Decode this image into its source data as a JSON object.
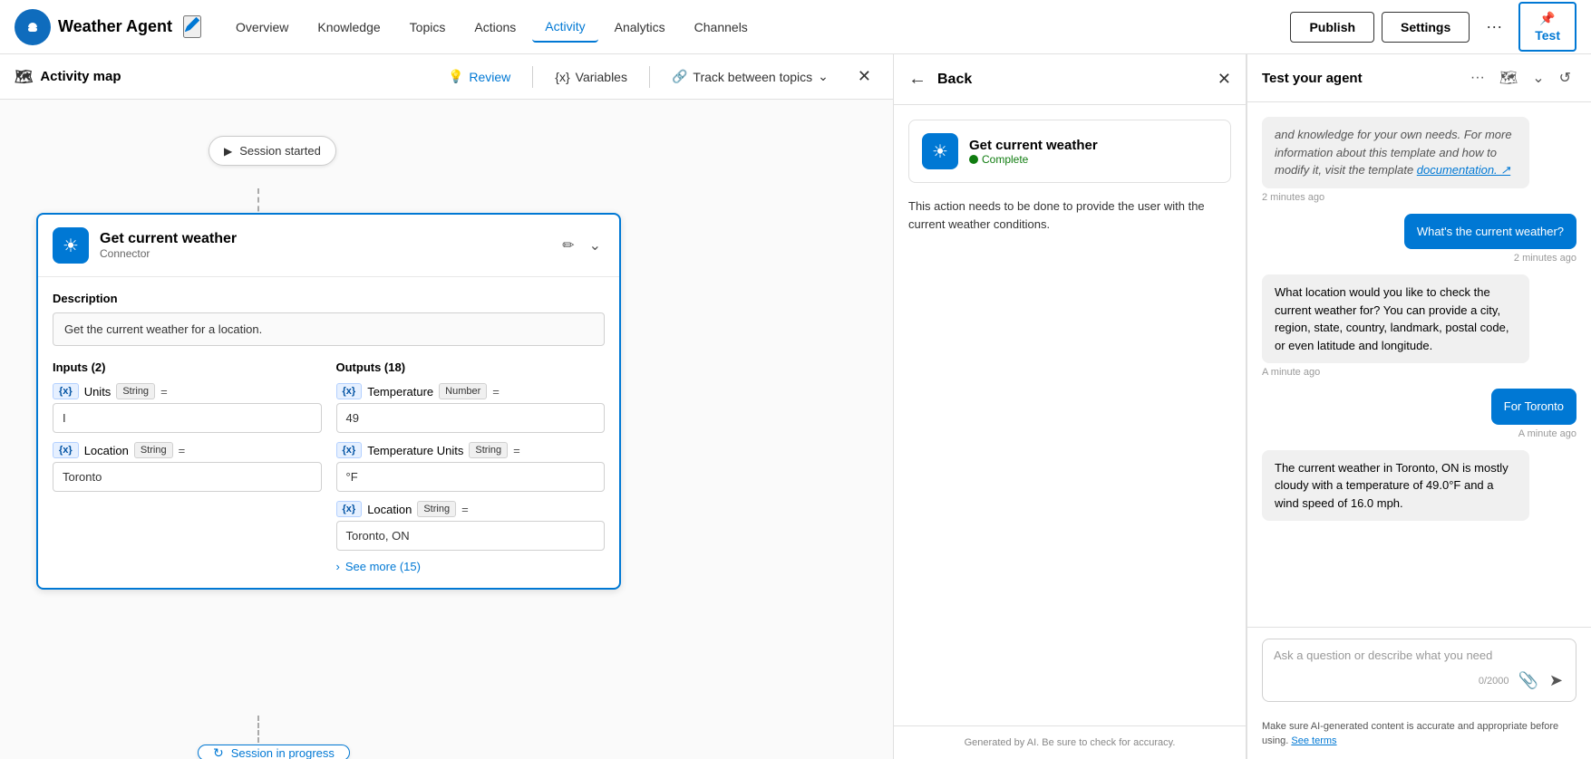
{
  "nav": {
    "title": "Weather Agent",
    "edit_icon": "✏",
    "links": [
      "Overview",
      "Knowledge",
      "Topics",
      "Actions",
      "Activity",
      "Analytics",
      "Channels"
    ],
    "active_link": "Activity",
    "publish_label": "Publish",
    "settings_label": "Settings",
    "more_label": "···",
    "test_label": "Test",
    "test_pin": "📌"
  },
  "toolbar": {
    "title": "Activity map",
    "map_icon": "🗺",
    "review_label": "Review",
    "variables_label": "Variables",
    "track_label": "Track between topics",
    "close_label": "✕"
  },
  "canvas": {
    "session_started_label": "Session started",
    "session_play": "▶",
    "session_progress_label": "Session in progress",
    "session_progress_icon": "↻"
  },
  "card": {
    "title": "Get current weather",
    "subtitle": "Connector",
    "icon": "☀",
    "description_label": "Description",
    "description": "Get the current weather for a location.",
    "inputs_label": "Inputs (2)",
    "outputs_label": "Outputs (18)",
    "inputs": [
      {
        "tag": "{x}",
        "name": "Units",
        "type": "String",
        "eq": "=",
        "value": "I"
      },
      {
        "tag": "{x}",
        "name": "Location",
        "type": "String",
        "eq": "=",
        "value": "Toronto"
      }
    ],
    "outputs": [
      {
        "tag": "{x}",
        "name": "Temperature",
        "type": "Number",
        "eq": "=",
        "value": "49"
      },
      {
        "tag": "{x}",
        "name": "Temperature Units",
        "type": "String",
        "eq": "=",
        "value": "°F"
      },
      {
        "tag": "{x}",
        "name": "Location",
        "type": "String",
        "eq": "=",
        "value": "Toronto, ON"
      }
    ],
    "see_more_label": "See more (15)",
    "see_more_icon": "›"
  },
  "action_panel": {
    "back_label": "←",
    "title": "Back",
    "close_label": "✕",
    "card_title": "Get current weather",
    "card_status": "Complete",
    "card_icon": "☀",
    "description": "This action needs to be done to provide the user with the current weather conditions.",
    "footer": "Generated by AI. Be sure to check for accuracy."
  },
  "chat": {
    "title": "Test your agent",
    "more_label": "···",
    "map_icon": "🗺",
    "expand_icon": "⌄",
    "refresh_icon": "↺",
    "messages": [
      {
        "type": "agent-italic",
        "text": "and knowledge for your own needs. For more information about this template and how to modify it, visit the template documentation.",
        "has_link": true,
        "link_text": "documentation.",
        "timestamp": "2 minutes ago",
        "timestamp_align": "left"
      },
      {
        "type": "user",
        "text": "What's the current weather?",
        "timestamp": "2 minutes ago",
        "timestamp_align": "right"
      },
      {
        "type": "agent",
        "text": "What location would you like to check the current weather for? You can provide a city, region, state, country, landmark, postal code, or even latitude and longitude.",
        "timestamp": "A minute ago",
        "timestamp_align": "left"
      },
      {
        "type": "user",
        "text": "For Toronto",
        "timestamp": "A minute ago",
        "timestamp_align": "right"
      },
      {
        "type": "agent",
        "text": "The current weather in Toronto, ON is mostly cloudy with a temperature of 49.0°F and a wind speed of 16.0 mph.",
        "timestamp": "",
        "timestamp_align": "left"
      }
    ],
    "input_placeholder": "Ask a question or describe what you need",
    "input_counter": "0/2000",
    "attach_icon": "📎",
    "send_icon": "➤",
    "footer": "Make sure AI-generated content is accurate and appropriate before using.",
    "footer_link": "See terms"
  }
}
